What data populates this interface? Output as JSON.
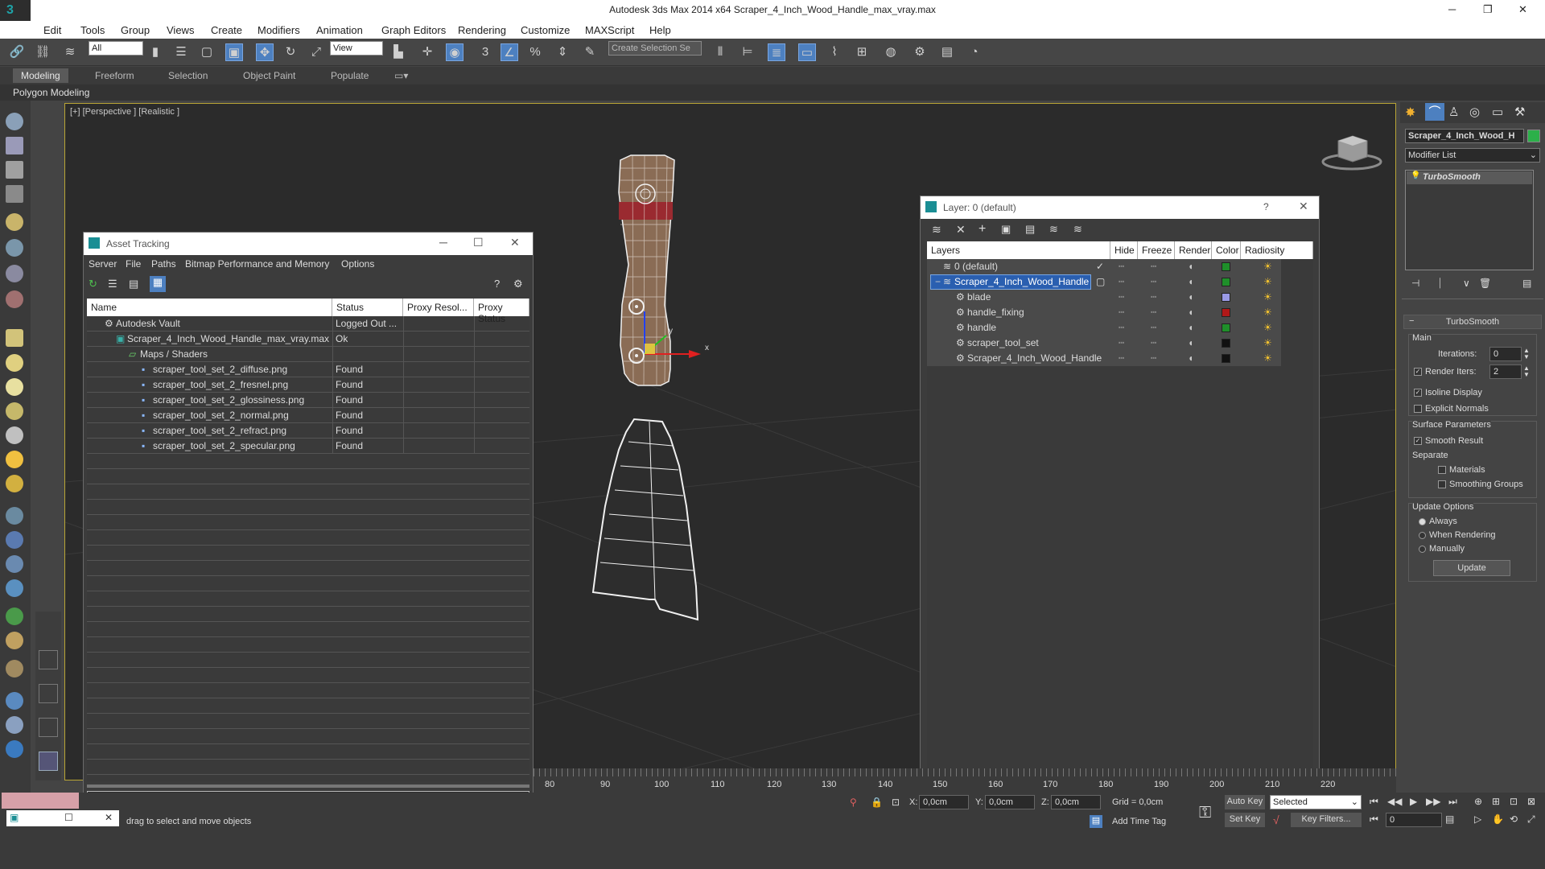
{
  "app": {
    "title": "Autodesk 3ds Max  2014 x64     Scraper_4_Inch_Wood_Handle_max_vray.max"
  },
  "menu": [
    "Edit",
    "Tools",
    "Group",
    "Views",
    "Create",
    "Modifiers",
    "Animation",
    "Graph Editors",
    "Rendering",
    "Customize",
    "MAXScript",
    "Help"
  ],
  "toolbar": {
    "filter_value": "All",
    "view_value": "View",
    "selection_set_placeholder": "Create Selection Se",
    "snap_num": "3"
  },
  "ribbon": {
    "tabs": [
      "Modeling",
      "Freeform",
      "Selection",
      "Object Paint",
      "Populate"
    ],
    "sub": "Polygon Modeling"
  },
  "viewport": {
    "label": "[+] [Perspective ] [Realistic ]",
    "axis_x": "x",
    "axis_y": "y"
  },
  "asset_tracking": {
    "title": "Asset Tracking",
    "menu": [
      "Server",
      "File",
      "Paths",
      "Bitmap Performance and Memory",
      "Options"
    ],
    "columns": [
      "Name",
      "Status",
      "Proxy Resol...",
      "Proxy Status"
    ],
    "rows": [
      {
        "name": "Autodesk Vault",
        "status": "Logged Out ..."
      },
      {
        "name": "Scraper_4_Inch_Wood_Handle_max_vray.max",
        "status": "Ok"
      },
      {
        "name": "Maps / Shaders",
        "status": ""
      },
      {
        "name": "scraper_tool_set_2_diffuse.png",
        "status": "Found"
      },
      {
        "name": "scraper_tool_set_2_fresnel.png",
        "status": "Found"
      },
      {
        "name": "scraper_tool_set_2_glossiness.png",
        "status": "Found"
      },
      {
        "name": "scraper_tool_set_2_normal.png",
        "status": "Found"
      },
      {
        "name": "scraper_tool_set_2_refract.png",
        "status": "Found"
      },
      {
        "name": "scraper_tool_set_2_specular.png",
        "status": "Found"
      }
    ]
  },
  "layer_dialog": {
    "title": "Layer: 0 (default)",
    "help": "?",
    "columns": [
      "Layers",
      "Hide",
      "Freeze",
      "Render",
      "Color",
      "Radiosity"
    ],
    "rows": [
      {
        "name": "0 (default)",
        "color": "#1f8f2a"
      },
      {
        "name": "Scraper_4_Inch_Wood_Handle",
        "color": "#1f8f2a"
      },
      {
        "name": "blade",
        "color": "#9a9ae6"
      },
      {
        "name": "handle_fixing",
        "color": "#b01818"
      },
      {
        "name": "handle",
        "color": "#1f8f2a"
      },
      {
        "name": "scraper_tool_set",
        "color": "#111111"
      },
      {
        "name": "Scraper_4_Inch_Wood_Handle",
        "color": "#111111"
      }
    ]
  },
  "command_panel": {
    "object_name": "Scraper_4_Inch_Wood_H",
    "modifier_list": "Modifier List",
    "modifier": "TurboSmooth",
    "rollout_title": "TurboSmooth",
    "main_label": "Main",
    "iterations_label": "Iterations:",
    "iterations_value": "0",
    "render_iters_label": "Render Iters:",
    "render_iters_value": "2",
    "isoline": "Isoline Display",
    "explicit_normals": "Explicit Normals",
    "surface_params": "Surface Parameters",
    "smooth_result": "Smooth Result",
    "separate": "Separate",
    "materials": "Materials",
    "smoothing_groups": "Smoothing Groups",
    "update_options": "Update Options",
    "always": "Always",
    "when_rendering": "When Rendering",
    "manually": "Manually",
    "update_button": "Update"
  },
  "timeline": {
    "ticks": [
      "80",
      "90",
      "100",
      "110",
      "120",
      "130",
      "140",
      "150",
      "160",
      "170",
      "180",
      "190",
      "200",
      "210",
      "220"
    ]
  },
  "status": {
    "x_label": "X:",
    "x_value": "0,0cm",
    "y_label": "Y:",
    "y_value": "0,0cm",
    "z_label": "Z:",
    "z_value": "0,0cm",
    "grid": "Grid = 0,0cm",
    "prompt": "drag to select and move objects",
    "add_time_tag": "Add Time Tag",
    "auto_key": "Auto Key",
    "set_key": "Set Key",
    "selected": "Selected",
    "key_filters": "Key Filters...",
    "frame": "0"
  }
}
